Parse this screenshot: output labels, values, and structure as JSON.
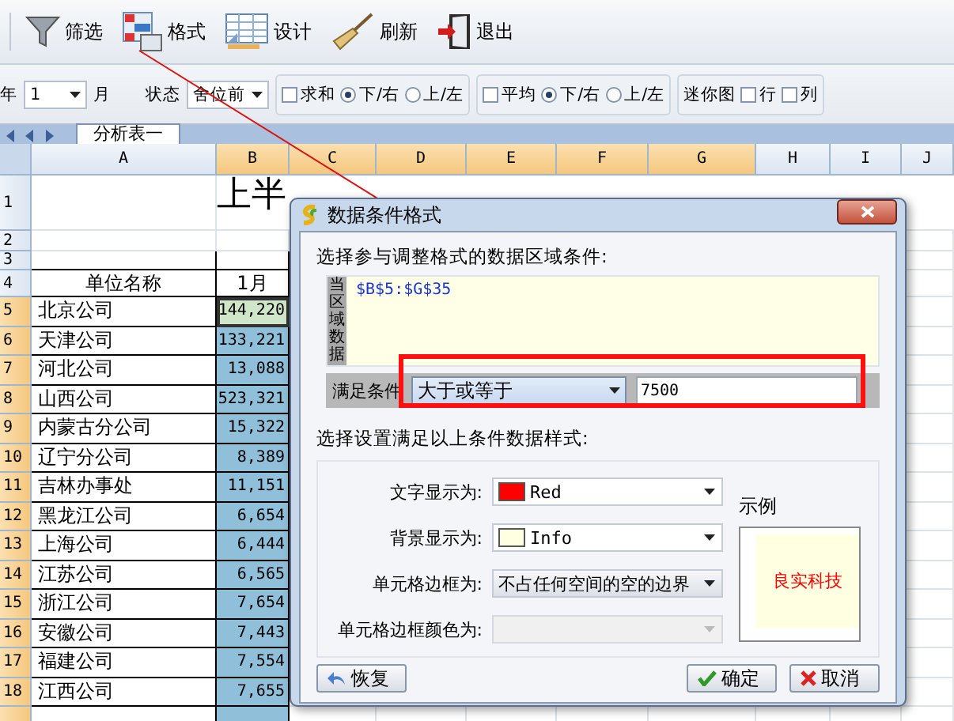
{
  "toolbar": {
    "buttons": [
      {
        "kind": "filter",
        "label": "筛选"
      },
      {
        "kind": "format",
        "label": "格式"
      },
      {
        "kind": "design",
        "label": "设计"
      },
      {
        "kind": "refresh",
        "label": "刷新"
      },
      {
        "kind": "exit",
        "label": "退出"
      }
    ]
  },
  "options": {
    "year_suffix": "年",
    "month": "1",
    "month_suffix": "月",
    "status_label": "状态",
    "status": "舍位前",
    "groups": [
      {
        "label": "求和",
        "checked": false,
        "radios": [
          {
            "label": "下/右",
            "selected": true
          },
          {
            "label": "上/左",
            "selected": false
          }
        ]
      },
      {
        "label": "平均",
        "checked": false,
        "radios": [
          {
            "label": "下/右",
            "selected": true
          },
          {
            "label": "上/左",
            "selected": false
          }
        ]
      }
    ],
    "sparkline": {
      "label": "迷你图",
      "checks": [
        {
          "label": "行",
          "checked": false
        },
        {
          "label": "列",
          "checked": false
        }
      ]
    }
  },
  "sheet_tabs": [
    {
      "label": "分析表一",
      "selected": true
    }
  ],
  "sheet": {
    "columns": [
      {
        "label": "A",
        "selected": false
      },
      {
        "label": "B",
        "selected": true
      },
      {
        "label": "C",
        "selected": true
      },
      {
        "label": "D",
        "selected": true
      },
      {
        "label": "E",
        "selected": true
      },
      {
        "label": "F",
        "selected": true
      },
      {
        "label": "G",
        "selected": true
      },
      {
        "label": "H",
        "selected": false
      },
      {
        "label": "I",
        "selected": false
      },
      {
        "label": "J",
        "selected": false
      }
    ],
    "title_row": "1",
    "title": "上半",
    "blank_rows": [
      "2",
      "3"
    ],
    "header_row": "4",
    "header": [
      "单位名称",
      "1月"
    ],
    "rows": [
      {
        "row": "5",
        "name": "北京公司",
        "value": "144,220",
        "selected": true,
        "active": true
      },
      {
        "row": "6",
        "name": "天津公司",
        "value": "133,221",
        "selected": true,
        "active": false
      },
      {
        "row": "7",
        "name": "河北公司",
        "value": "13,088",
        "selected": true,
        "active": false
      },
      {
        "row": "8",
        "name": "山西公司",
        "value": "523,321",
        "selected": true,
        "active": false
      },
      {
        "row": "9",
        "name": "内蒙古分公司",
        "value": "15,322",
        "selected": true,
        "active": false
      },
      {
        "row": "10",
        "name": "辽宁分公司",
        "value": "8,389",
        "selected": true,
        "active": false
      },
      {
        "row": "11",
        "name": "吉林办事处",
        "value": "11,151",
        "selected": true,
        "active": false
      },
      {
        "row": "12",
        "name": "黑龙江公司",
        "value": "6,654",
        "selected": true,
        "active": false
      },
      {
        "row": "13",
        "name": "上海公司",
        "value": "6,444",
        "selected": true,
        "active": false
      },
      {
        "row": "14",
        "name": "江苏公司",
        "value": "6,565",
        "selected": true,
        "active": false
      },
      {
        "row": "15",
        "name": "浙江公司",
        "value": "7,654",
        "selected": true,
        "active": false
      },
      {
        "row": "16",
        "name": "安徽公司",
        "value": "7,443",
        "selected": true,
        "active": false
      },
      {
        "row": "17",
        "name": "福建公司",
        "value": "7,554",
        "selected": true,
        "active": false
      },
      {
        "row": "18",
        "name": "江西公司",
        "value": "7,655",
        "selected": true,
        "active": false
      }
    ]
  },
  "dialog": {
    "title": "数据条件格式",
    "section_1": "选择参与调整格式的数据区域条件:",
    "range_label": "当区域数据",
    "range": "$B$5:$G$35",
    "condition_label": "满足条件",
    "condition": "大于或等于",
    "condition_value": "7500",
    "section_2": "选择设置满足以上条件数据样式:",
    "fields": [
      {
        "kind": "color",
        "label": "文字显示为:",
        "value": "Red",
        "color": "#ff0000",
        "disabled": false
      },
      {
        "kind": "color",
        "label": "背景显示为:",
        "value": "Info",
        "color": "#ffffe1",
        "disabled": false
      },
      {
        "kind": "select",
        "label": "单元格边框为:",
        "value": "不占任何空间的空的边界",
        "disabled": false
      },
      {
        "kind": "select",
        "label": "单元格边框颜色为:",
        "disabled": true
      }
    ],
    "sample_label": "示例",
    "sample_text": "良实科技",
    "reset_button": "恢复",
    "ok_button": "确定",
    "cancel_button": "取消"
  }
}
